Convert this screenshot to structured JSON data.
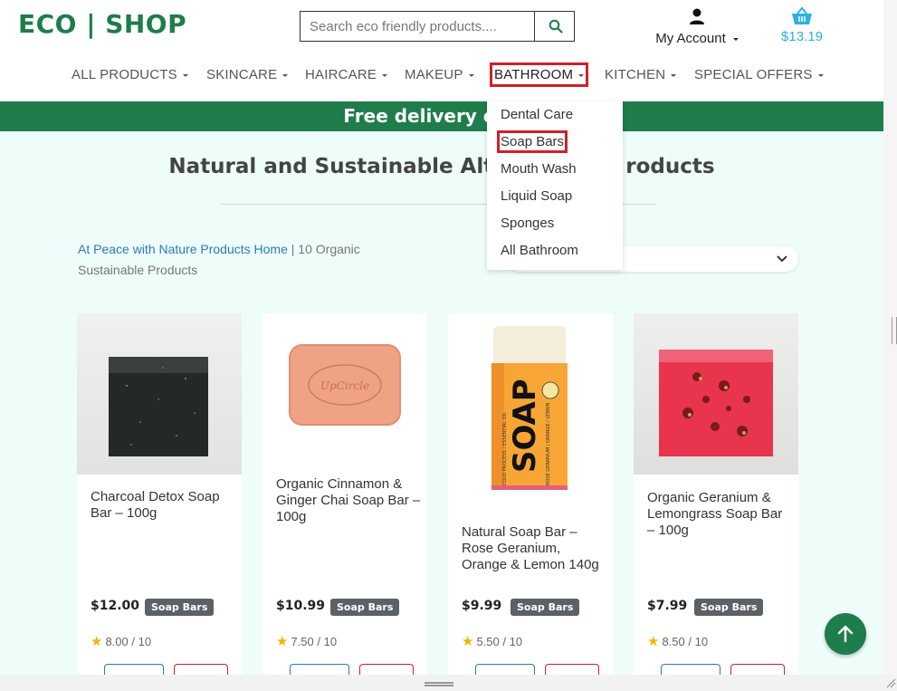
{
  "header": {
    "logo": "ECO | SHOP",
    "search": {
      "placeholder": "Search eco friendly products...."
    },
    "account_label": "My Account",
    "cart_total": "$13.19"
  },
  "nav": {
    "items": [
      {
        "label": "ALL PRODUCTS"
      },
      {
        "label": "SKINCARE"
      },
      {
        "label": "HAIRCARE"
      },
      {
        "label": "MAKEUP"
      },
      {
        "label": "BATHROOM"
      },
      {
        "label": "KITCHEN"
      },
      {
        "label": "SPECIAL OFFERS"
      }
    ],
    "active": "BATHROOM"
  },
  "banner": {
    "text": "Free delivery on $8"
  },
  "page": {
    "heading": "Natural and Sustainable Alt",
    "heading_tail": "roducts",
    "breadcrumb_link": "At Peace with Nature Products Home",
    "breadcrumb_rest": " | 10 Organic Sustainable Products"
  },
  "dropdown": {
    "items": [
      {
        "label": "Dental Care"
      },
      {
        "label": "Soap Bars"
      },
      {
        "label": "Mouth Wash"
      },
      {
        "label": "Liquid Soap"
      },
      {
        "label": "Sponges"
      },
      {
        "label": "All Bathroom"
      }
    ],
    "active": "Soap Bars"
  },
  "products": [
    {
      "title": "Charcoal Detox Soap Bar – 100g",
      "price": "$12.00",
      "tag": "Soap Bars",
      "rating": "8.00 / 10"
    },
    {
      "title": "Organic Cinnamon & Ginger Chai Soap Bar – 100g",
      "price": "$10.99",
      "tag": "Soap Bars",
      "rating": "7.50 / 10"
    },
    {
      "title": "Natural Soap Bar – Rose Geranium, Orange & Lemon 140g",
      "price": "$9.99",
      "tag": "Soap Bars",
      "rating": "5.50 / 10"
    },
    {
      "title": "Organic Geranium & Lemongrass Soap Bar – 100g",
      "price": "$7.99",
      "tag": "Soap Bars",
      "rating": "8.50 / 10"
    }
  ],
  "product_images": {
    "p2_stamp": "UpCircle",
    "p3_brand": "SOAP",
    "p3_side": "COLD PROCESS / ESSENTIAL OIL",
    "p3_side2": "ROSE GERANIUM / ORANGE / LEMON"
  },
  "colors": {
    "brand_green": "#1e7d4b",
    "cart_blue": "#2bb2e0",
    "highlight_red": "#d0202a",
    "link_blue": "#2a7bb8"
  }
}
